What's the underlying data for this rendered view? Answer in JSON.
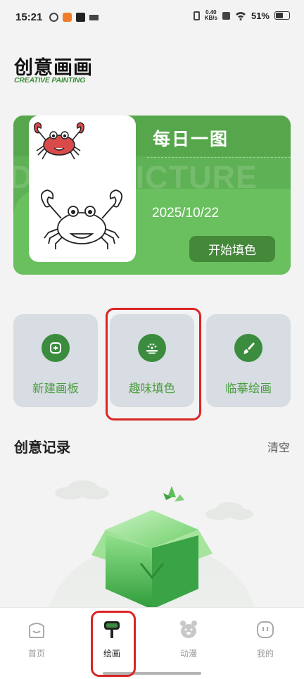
{
  "status_bar": {
    "time": "15:21",
    "net_speed": "0.40",
    "net_unit": "KB/s",
    "battery": "51%"
  },
  "header": {
    "title": "创意画画",
    "subtitle": "CREATIVE PAINTING"
  },
  "daily_card": {
    "title": "每日一图",
    "watermark": "DAILY PICTURE",
    "date": "2025/10/22",
    "start_button": "开始填色"
  },
  "actions": [
    {
      "label": "新建画板",
      "icon": "plus-square-icon"
    },
    {
      "label": "趣味填色",
      "icon": "palette-icon"
    },
    {
      "label": "临摹绘画",
      "icon": "brush-icon"
    }
  ],
  "records": {
    "title": "创意记录",
    "clear_label": "清空"
  },
  "tabbar": {
    "items": [
      {
        "label": "首页",
        "icon": "home-icon",
        "active": false
      },
      {
        "label": "绘画",
        "icon": "paint-roller-icon",
        "active": true
      },
      {
        "label": "动漫",
        "icon": "bear-icon",
        "active": false
      },
      {
        "label": "我的",
        "icon": "profile-icon",
        "active": false
      }
    ]
  },
  "colors": {
    "accent_green": "#3b8c3e",
    "card_green": "#5eb154",
    "highlight_red": "#d92525"
  }
}
